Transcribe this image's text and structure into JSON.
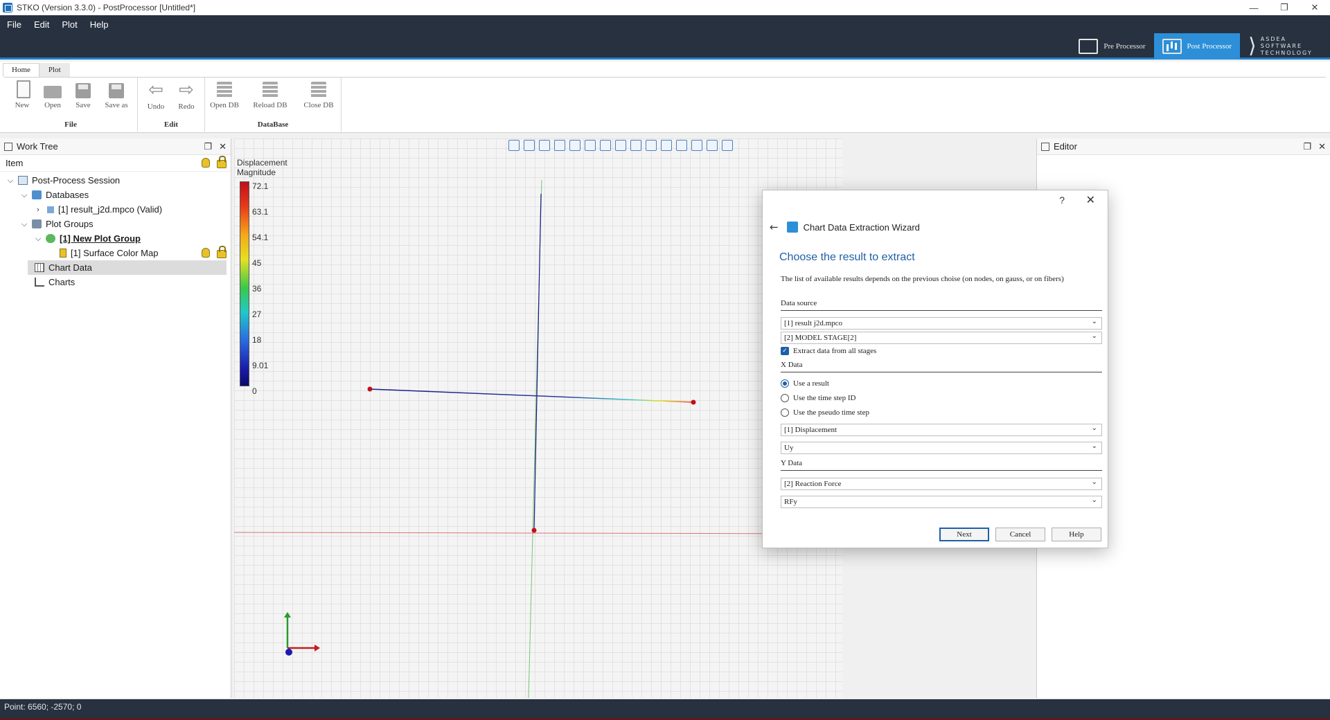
{
  "window": {
    "title": "STKO (Version 3.3.0) - PostProcessor [Untitled*]",
    "controls": [
      "—",
      "❐",
      "✕"
    ]
  },
  "menu": [
    "File",
    "Edit",
    "Plot",
    "Help"
  ],
  "modes": {
    "pre": "Pre Processor",
    "post": "Post Processor",
    "logo_mark": "⟩",
    "logo_words": [
      "ASDEA",
      "SOFTWARE",
      "TECHNOLOGY"
    ]
  },
  "ribbon": {
    "tabs": [
      "Home",
      "Plot"
    ],
    "groups": {
      "file": {
        "name": "File",
        "buttons": [
          "New",
          "Open",
          "Save",
          "Save as"
        ]
      },
      "edit": {
        "name": "Edit",
        "buttons": [
          "Undo",
          "Redo"
        ]
      },
      "database": {
        "name": "DataBase",
        "buttons": [
          "Open DB",
          "Reload DB",
          "Close DB"
        ]
      }
    },
    "arrows": {
      "undo": "⇦",
      "redo": "⇨"
    }
  },
  "worktree": {
    "title": "Work Tree",
    "header": "Item",
    "rows": [
      {
        "chevron": "⌵",
        "label": "Post-Process Session"
      },
      {
        "chevron": "⌵",
        "label": "Databases"
      },
      {
        "chevron": "›",
        "label": "[1] result_j2d.mpco (Valid)"
      },
      {
        "chevron": "⌵",
        "label": "Plot Groups"
      },
      {
        "chevron": "⌵",
        "label": "[1] New Plot Group"
      },
      {
        "chevron": "",
        "label": "[1] Surface Color Map"
      },
      {
        "chevron": "",
        "label": "Chart Data"
      },
      {
        "chevron": "",
        "label": "Charts"
      }
    ]
  },
  "panel_buttons": {
    "float": "❐",
    "close": "✕"
  },
  "viewport": {
    "legend_title": [
      "Displacement",
      "Magnitude"
    ],
    "legend_ticks": [
      "72.1",
      "63.1",
      "54.1",
      "45",
      "36",
      "27",
      "18",
      "9.01",
      "0"
    ]
  },
  "editor": {
    "title": "Editor"
  },
  "statusbar": {
    "text": "Point: 6560; -2570; 0"
  },
  "wizard": {
    "help": "?",
    "close": "✕",
    "back": "←",
    "title": "Chart Data Extraction Wizard",
    "subtitle": "Choose the result to extract",
    "description": "The list of available results depends on the previous choise (on nodes, on gauss, or on fibers)",
    "data_source_label": "Data source",
    "data_source_db": "[1] result j2d.mpco",
    "data_source_stage": "[2] MODEL STAGE[2]",
    "extract_all_label": "Extract data from all stages",
    "check_mark": "✓",
    "x_data_label": "X Data",
    "x_options": [
      "Use a result",
      "Use the time step ID",
      "Use the pseudo time step"
    ],
    "x_result": "[1] Displacement",
    "x_component": "Uy",
    "y_data_label": "Y Data",
    "y_result": "[2] Reaction Force",
    "y_component": "RFy",
    "combo_arrow": "⌄",
    "buttons": {
      "next": "Next",
      "cancel": "Cancel",
      "help": "Help"
    }
  }
}
